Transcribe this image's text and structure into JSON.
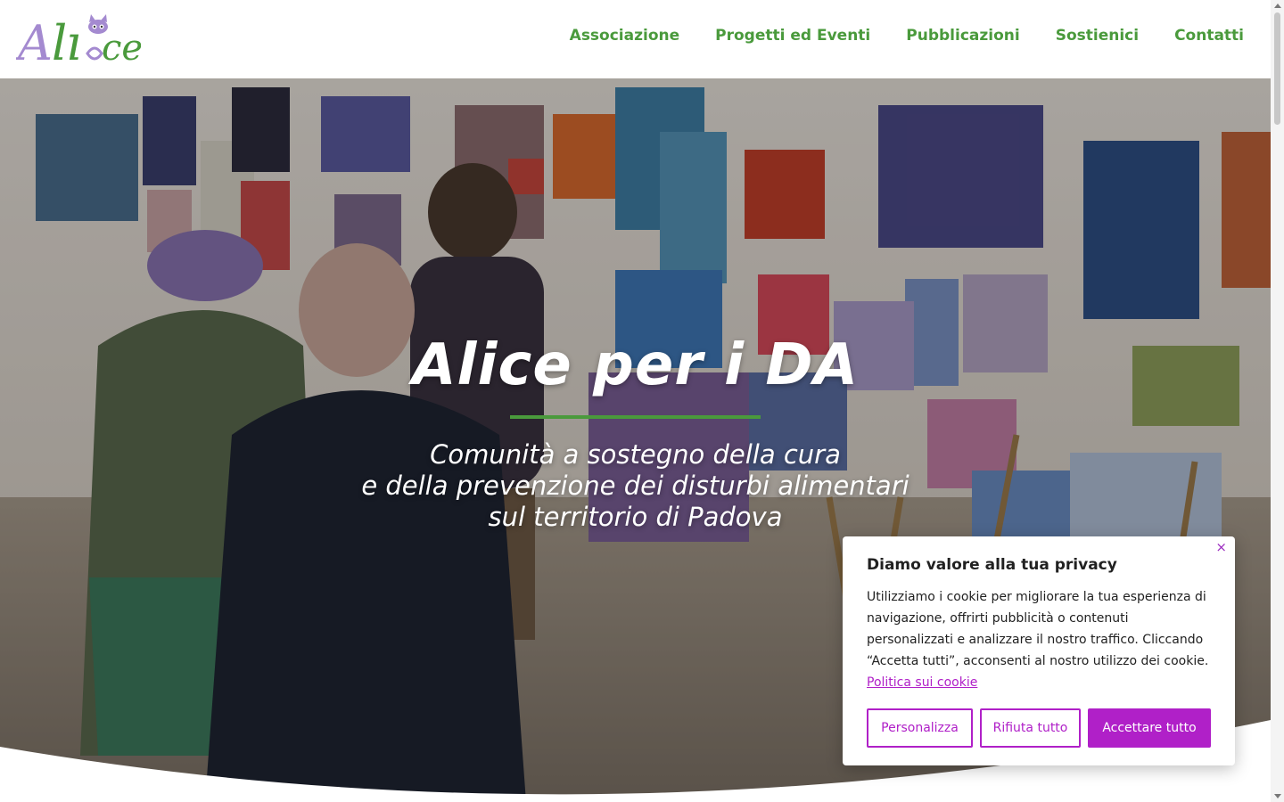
{
  "logo": {
    "text": "Alice",
    "icon": "cat-logo-icon"
  },
  "nav": {
    "items": [
      {
        "label": "Associazione"
      },
      {
        "label": "Progetti ed Eventi"
      },
      {
        "label": "Pubblicazioni"
      },
      {
        "label": "Sostienici"
      },
      {
        "label": "Contatti"
      }
    ]
  },
  "hero": {
    "title": "Alice per i DA",
    "subtitle_lines": [
      "Comunità a sostegno della cura",
      "e della prevenzione dei disturbi alimentari",
      "sul territorio di Padova"
    ],
    "background": "art-exhibition-photo"
  },
  "cookie_banner": {
    "title": "Diamo valore alla tua privacy",
    "text": "Utilizziamo i cookie per migliorare la tua esperienza di navigazione, offrirti pubblicità o contenuti personalizzati e analizzare il nostro traffico. Cliccando “Accetta tutti”, acconsenti al nostro utilizzo dei cookie.",
    "link": "Politica sui cookie",
    "close_icon": "×",
    "buttons": {
      "customize": "Personalizza",
      "reject": "Rifiuta tutto",
      "accept": "Accettare tutto"
    }
  },
  "colors": {
    "brand_green": "#4a9a3c",
    "brand_purple": "#b020c8",
    "logo_lilac": "#a48ad0"
  }
}
